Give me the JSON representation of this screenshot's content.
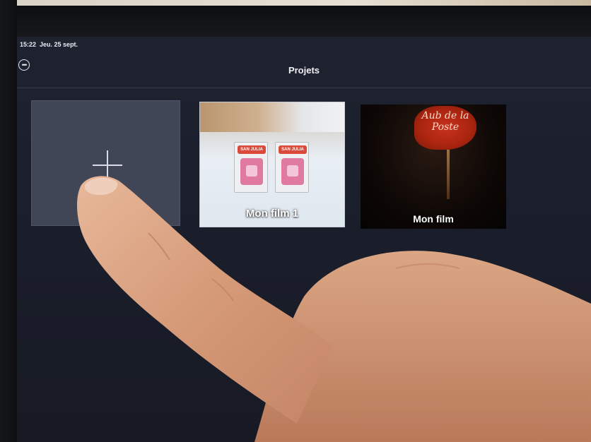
{
  "status_bar": {
    "time": "15:22",
    "date": "Jeu. 25 sept."
  },
  "header": {
    "title": "Projets",
    "more_icon": "ellipsis-circle-icon"
  },
  "projects": [
    {
      "kind": "new",
      "icon": "plus-icon"
    },
    {
      "kind": "film",
      "name": "Mon film 1",
      "box_brand": "SAN JULIA"
    },
    {
      "kind": "film",
      "name": "Mon film",
      "sign_text": "Aub de la Poste"
    }
  ],
  "colors": {
    "screen_bg": "#1d2130",
    "new_tile_bg": "#414657",
    "text": "#eef0f5"
  }
}
